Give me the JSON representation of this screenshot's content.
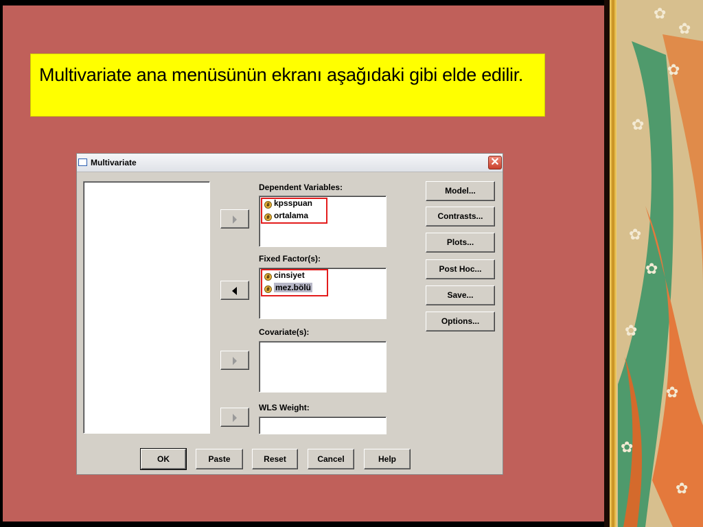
{
  "caption": "Multivariate ana menüsünün ekranı aşağıdaki gibi elde edilir.",
  "dialog": {
    "title": "Multivariate",
    "close_glyph": "✕",
    "dependent": {
      "label": "Dependent Variables:",
      "items": [
        "kpsspuan",
        "ortalama"
      ]
    },
    "fixed": {
      "label": "Fixed Factor(s):",
      "items": [
        "cinsiyet",
        "mez.bölü"
      ]
    },
    "covariates": {
      "label": "Covariate(s):"
    },
    "wls": {
      "label": "WLS Weight:"
    },
    "side_buttons": [
      "Model...",
      "Contrasts...",
      "Plots...",
      "Post Hoc...",
      "Save...",
      "Options..."
    ],
    "bottom_buttons": [
      "OK",
      "Paste",
      "Reset",
      "Cancel",
      "Help"
    ],
    "variable_icon": "#"
  },
  "colors": {
    "slide_background": "#c0605a",
    "caption_background": "#ffff00",
    "highlight_box": "#e31b1b",
    "dialog_face": "#d4d0c8"
  }
}
